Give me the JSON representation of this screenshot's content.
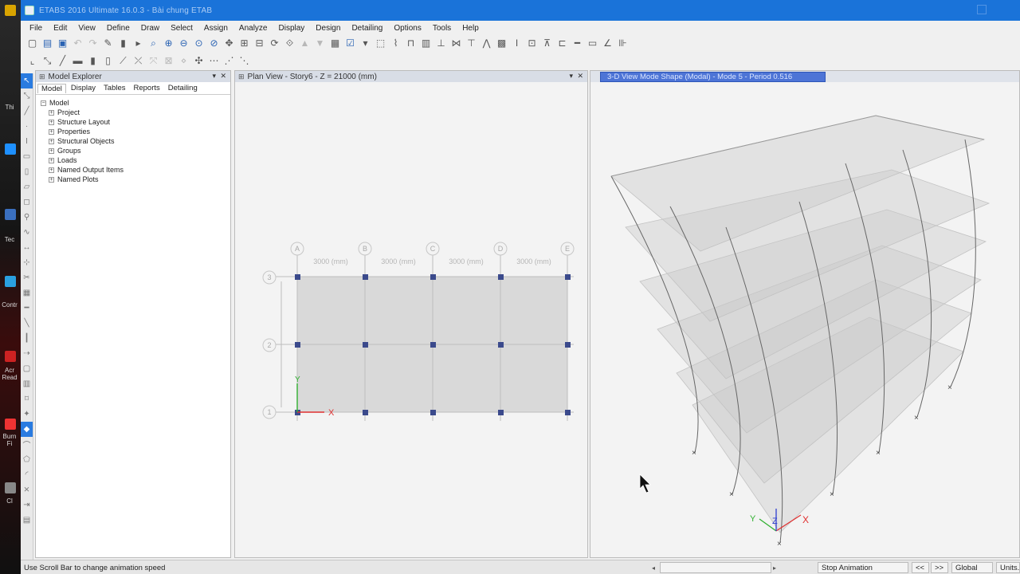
{
  "desktop": {
    "labels": [
      "Thi",
      "Tec",
      "Contr",
      "Acr Read",
      "Burn Fi",
      "Cl"
    ]
  },
  "window": {
    "title": "ETABS 2016 Ultimate 16.0.3 - Bài chung ETAB"
  },
  "menu": [
    "File",
    "Edit",
    "View",
    "Define",
    "Draw",
    "Select",
    "Assign",
    "Analyze",
    "Display",
    "Design",
    "Detailing",
    "Options",
    "Tools",
    "Help"
  ],
  "explorer": {
    "title": "Model Explorer",
    "tabs": [
      "Model",
      "Display",
      "Tables",
      "Reports",
      "Detailing"
    ],
    "root": "Model",
    "items": [
      "Project",
      "Structure Layout",
      "Properties",
      "Structural Objects",
      "Groups",
      "Loads",
      "Named Output Items",
      "Named Plots"
    ]
  },
  "plan": {
    "title": "Plan View - Story6 - Z = 21000 (mm)",
    "grid_x": [
      "A",
      "B",
      "C",
      "D",
      "E"
    ],
    "grid_y": [
      "3",
      "2",
      "1"
    ],
    "dim_label": "3000 (mm)",
    "axis_x": "X",
    "axis_y": "Y"
  },
  "view3d": {
    "title": "3-D View  Mode Shape (Modal) - Mode 5 - Period 0.516",
    "axis_x": "X",
    "axis_y": "Y",
    "axis_z": "Z"
  },
  "status": {
    "hint": "Use Scroll Bar to change animation speed",
    "stop_animation": "Stop Animation",
    "nav_prev": "<<",
    "nav_next": ">>",
    "coord_system": "Global",
    "units": "Units..."
  },
  "colors": {
    "titlebar": "#1a73d9",
    "active_tab": "#4d74d6",
    "joint": "#3b4a8c",
    "axis_x": "#e03030",
    "axis_y": "#30b030",
    "axis_z": "#3040d0"
  }
}
